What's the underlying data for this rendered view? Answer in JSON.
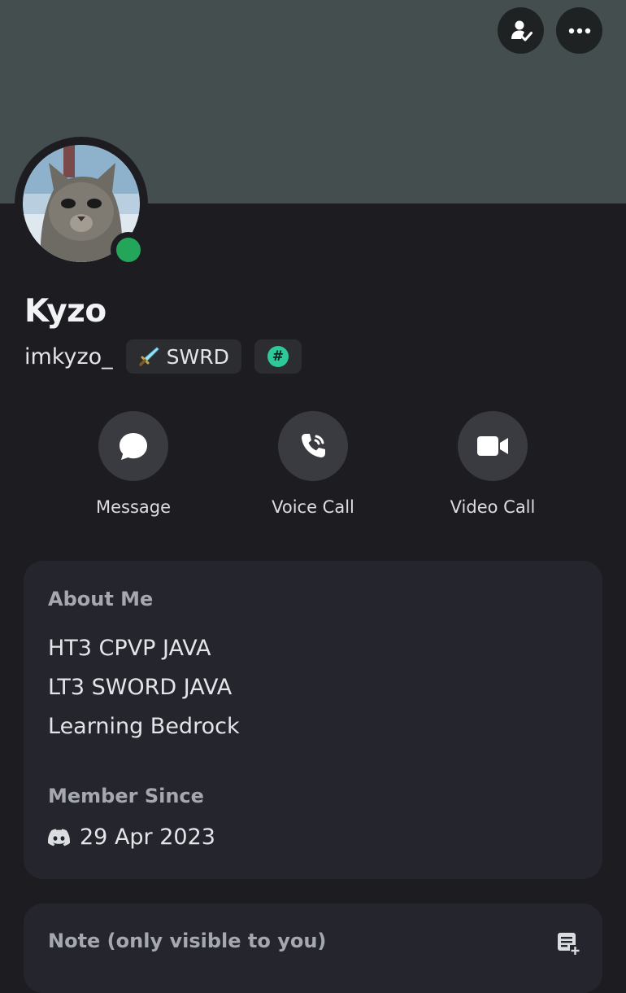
{
  "profile": {
    "display_name": "Kyzo",
    "username": "imkyzo_",
    "tag_label": "SWRD",
    "hash_badge": "#",
    "status": "online",
    "status_color": "#23a55a",
    "banner_color": "#454e4e"
  },
  "header": {
    "icons": [
      "friend-check-icon",
      "more-options-icon"
    ]
  },
  "actions": [
    {
      "label": "Message",
      "icon": "chat-bubble-icon"
    },
    {
      "label": "Voice Call",
      "icon": "phone-icon"
    },
    {
      "label": "Video Call",
      "icon": "video-camera-icon"
    }
  ],
  "about": {
    "heading": "About Me",
    "lines": [
      "HT3 CPVP JAVA",
      "LT3 SWORD JAVA",
      "Learning Bedrock"
    ]
  },
  "member_since": {
    "heading": "Member Since",
    "date": "29 Apr 2023",
    "icon": "discord-logo-icon"
  },
  "note": {
    "placeholder": "Note (only visible to you)",
    "icon": "add-note-icon"
  }
}
